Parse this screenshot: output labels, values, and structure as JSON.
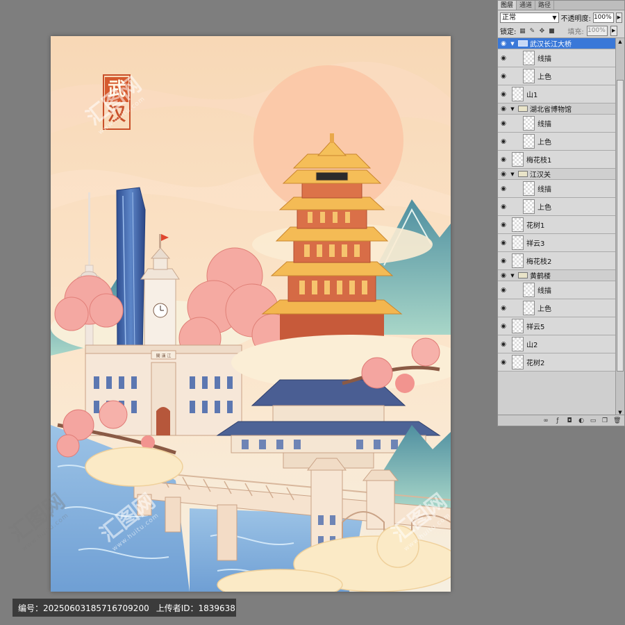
{
  "artwork": {
    "title_top": "武",
    "title_bottom": "汉",
    "sign_museum": "楼 鹤 黄",
    "sign_clock": "關 漢 江",
    "colors": {
      "sky_top": "#f9d9b8",
      "sky_bottom": "#fbe7cf",
      "sun": "#fbc9a8",
      "pagoda_gold": "#f2b24f",
      "pagoda_red": "#d86a45",
      "blossom": "#f4a6a0",
      "water": "#8fb9e0",
      "mountain": "#7fb8b0",
      "cloud": "#fbeed0",
      "roof_blue": "#4a5f93",
      "tower_blue": "#3d63a8"
    }
  },
  "watermarks": {
    "brand": "汇图网",
    "url": "www.huitu.com"
  },
  "footer": {
    "id_label": "编号：",
    "id_value": "20250603185716709200",
    "uploader_label": "上传者ID：",
    "uploader_value": "1839638"
  },
  "layers_panel": {
    "tabs": [
      "图层",
      "通道",
      "路径"
    ],
    "blend_mode": "正常",
    "opacity_label": "不透明度:",
    "opacity_value": "100%",
    "lock_label": "锁定:",
    "fill_label": "填充:",
    "fill_value": "100%",
    "layers": [
      {
        "name": "武汉长江大桥",
        "kind": "group",
        "selected": true
      },
      {
        "name": "线描",
        "kind": "child"
      },
      {
        "name": "上色",
        "kind": "child"
      },
      {
        "name": "山1",
        "kind": "layer"
      },
      {
        "name": "湖北省博物馆",
        "kind": "group"
      },
      {
        "name": "线描",
        "kind": "child"
      },
      {
        "name": "上色",
        "kind": "child"
      },
      {
        "name": "梅花枝1",
        "kind": "layer"
      },
      {
        "name": "江汉关",
        "kind": "group"
      },
      {
        "name": "线描",
        "kind": "child"
      },
      {
        "name": "上色",
        "kind": "child"
      },
      {
        "name": "花树1",
        "kind": "layer"
      },
      {
        "name": "祥云3",
        "kind": "layer"
      },
      {
        "name": "梅花枝2",
        "kind": "layer"
      },
      {
        "name": "黄鹤楼",
        "kind": "group"
      },
      {
        "name": "线描",
        "kind": "child"
      },
      {
        "name": "上色",
        "kind": "child"
      },
      {
        "name": "祥云5",
        "kind": "layer"
      },
      {
        "name": "山2",
        "kind": "layer"
      },
      {
        "name": "花树2",
        "kind": "layer"
      }
    ]
  }
}
